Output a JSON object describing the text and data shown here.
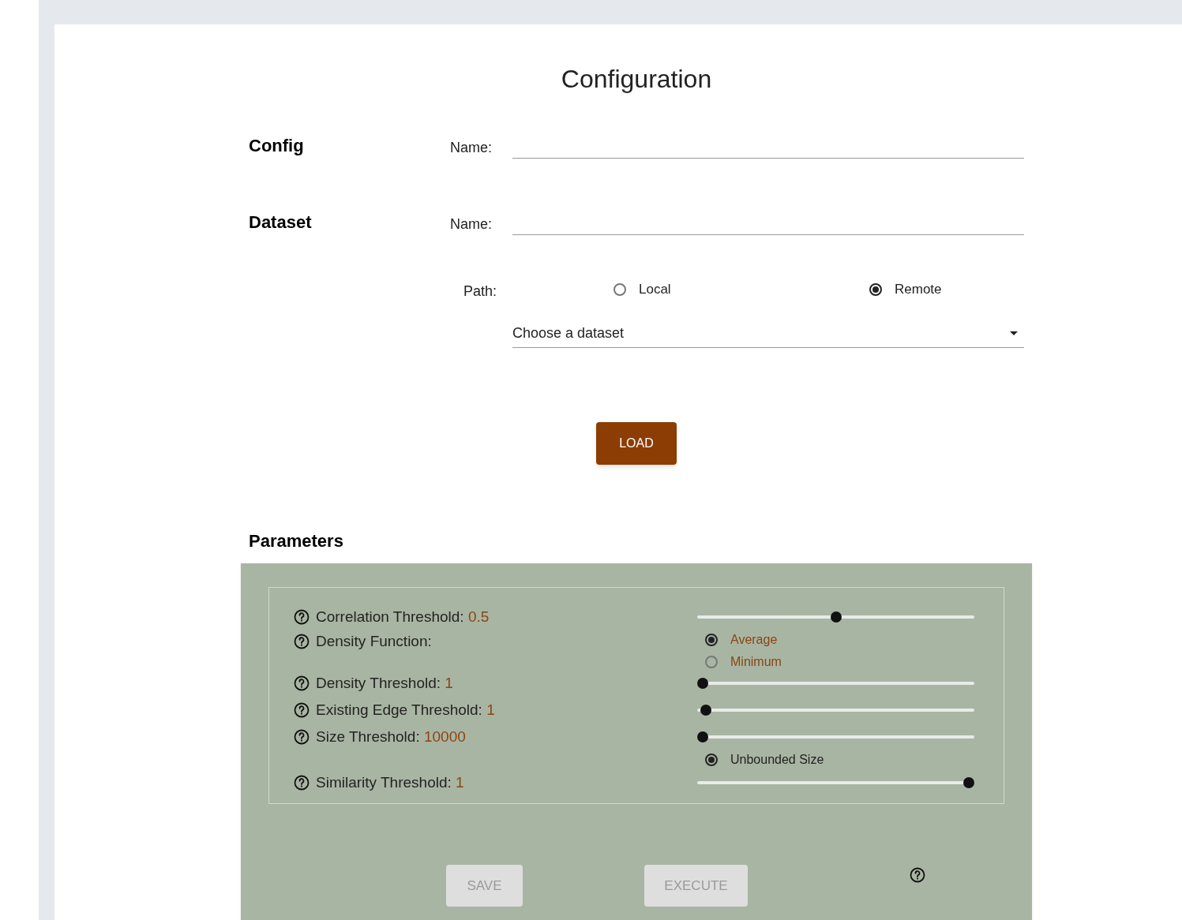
{
  "title": "Configuration",
  "config": {
    "heading": "Config",
    "name_label": "Name:"
  },
  "dataset": {
    "heading": "Dataset",
    "name_label": "Name:",
    "path_label": "Path:",
    "path_options": [
      {
        "label": "Local",
        "selected": false
      },
      {
        "label": "Remote",
        "selected": true
      }
    ],
    "select_placeholder": "Choose a dataset"
  },
  "load_button": "LOAD",
  "parameters": {
    "heading": "Parameters",
    "rows": [
      {
        "kind": "slider",
        "label": "Correlation Threshold:",
        "value": "0.5",
        "level": 0.5
      },
      {
        "kind": "radio_group",
        "label": "Density Function:",
        "options": [
          {
            "label": "Average",
            "selected": true
          },
          {
            "label": "Minimum",
            "selected": false
          }
        ]
      },
      {
        "kind": "slider",
        "label": "Density Threshold:",
        "value": "1",
        "level": 0.02
      },
      {
        "kind": "slider",
        "label": "Existing Edge Threshold:",
        "value": "1",
        "level": 0.03
      },
      {
        "kind": "slider",
        "label": "Size Threshold:",
        "value": "10000",
        "level": 0.02
      },
      {
        "kind": "option",
        "label": "Unbounded Size",
        "selected": true
      },
      {
        "kind": "slider",
        "label": "Similarity Threshold:",
        "value": "1",
        "level": 0.98
      }
    ],
    "buttons": [
      {
        "label": "SAVE",
        "disabled": true
      },
      {
        "label": "EXECUTE",
        "disabled": true
      }
    ]
  }
}
